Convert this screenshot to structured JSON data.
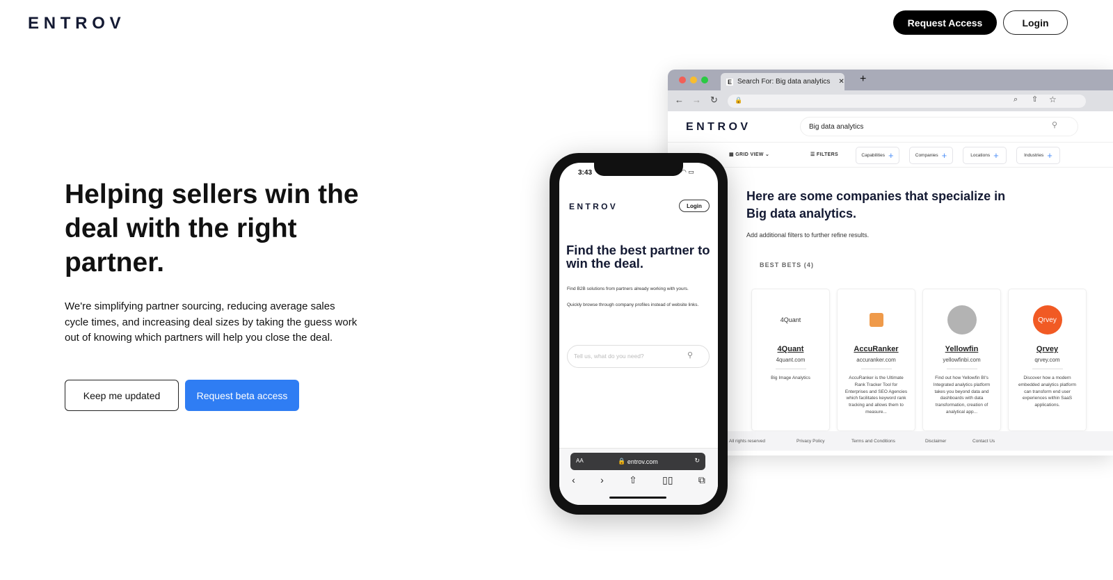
{
  "header": {
    "logo": "ENTROV",
    "request_access": "Request Access",
    "login": "Login"
  },
  "hero": {
    "title": "Helping sellers win the deal with the right partner.",
    "description": "We're simplifying partner sourcing, reducing average sales cycle times, and increasing deal sizes by taking the guess work out of knowing which partners will help you close the deal.",
    "keep_updated": "Keep me updated",
    "beta_access": "Request beta access"
  },
  "colors": {
    "accent": "#2f7df3",
    "brand": "#141a33",
    "qrvey": "#f15a24",
    "accuranker": "#ef9a4a"
  },
  "browser": {
    "tab_title": "Search For: Big data analytics",
    "tab_favicon": "E",
    "site_logo": "ENTROV",
    "search_value": "Big data analytics",
    "grid_view": "GRID VIEW",
    "filters": "FILTERS",
    "chips": [
      "Capabilities",
      "Companies",
      "Locations",
      "Industries"
    ],
    "results_title": "Here are some companies that specialize in Big data analytics.",
    "results_sub": "Add additional filters to further refine results.",
    "best_bets": "BEST BETS (4)",
    "cards": [
      {
        "logo": "4Quant",
        "name": "4Quant",
        "domain": "4quant.com",
        "desc": "Big Image Analytics"
      },
      {
        "logo": "",
        "name": "AccuRanker",
        "domain": "accuranker.com",
        "desc": "AccuRanker is the Ultimate Rank Tracker Tool for Enterprises and SEO Agencies which facilitates keyword rank tracking and allows them to measure..."
      },
      {
        "logo": "",
        "name": "Yellowfin",
        "domain": "yellowfinbi.com",
        "desc": "Find out how Yellowfin BI's Integrated analytics platform takes you beyond data and dashboards with data transformation, creation of analytical app..."
      },
      {
        "logo": "Qrvey",
        "name": "Qrvey",
        "domain": "qrvey.com",
        "desc": "Discover how a modern embedded analytics platform can transform end user experiences within SaaS applications."
      }
    ],
    "footer": [
      "v. All rights reserved",
      "Privacy Policy",
      "Terms and Conditions",
      "Disclaimer",
      "Contact Us"
    ]
  },
  "phone": {
    "time": "3:43",
    "logo": "ENTROV",
    "login": "Login",
    "title": "Find the best partner to win the deal.",
    "text1": "Find B2B solutions from partners already working with yours.",
    "text2": "Quickly browse through company profiles instead of website links.",
    "search_placeholder": "Tell us, what do you need?",
    "aa": "AA",
    "url": "entrov.com"
  }
}
